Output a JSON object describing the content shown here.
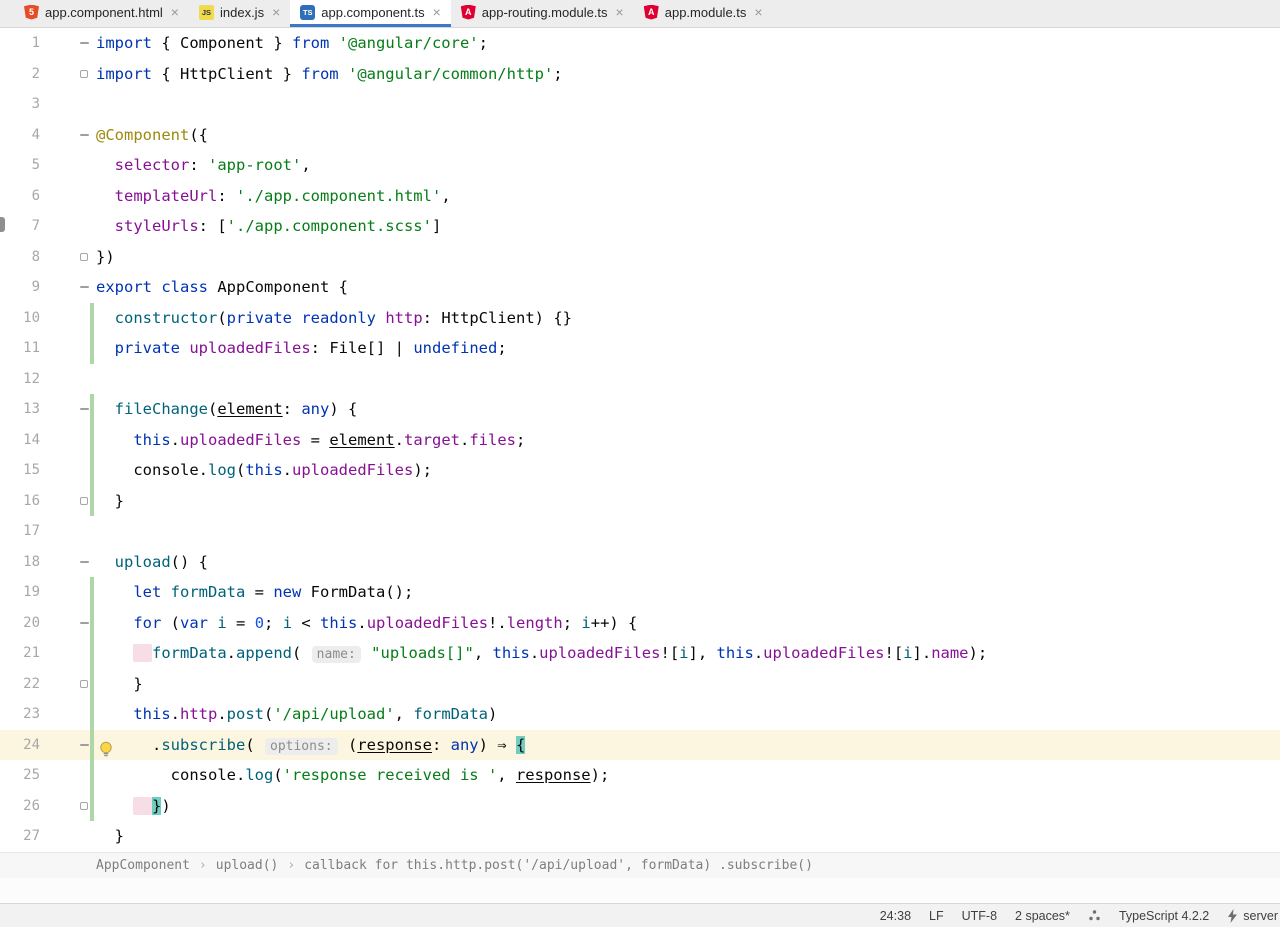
{
  "tab_bar": {
    "close_glyph": "×",
    "icon_glyphs": {
      "html": "5",
      "js": "JS",
      "ts": "TS",
      "ng": "A"
    },
    "tabs": [
      {
        "label": "app.component.html",
        "icon": "html",
        "active": false
      },
      {
        "label": "index.js",
        "icon": "js",
        "active": false
      },
      {
        "label": "app.component.ts",
        "icon": "ts",
        "active": true
      },
      {
        "label": "app-routing.module.ts",
        "icon": "ng",
        "active": false
      },
      {
        "label": "app.module.ts",
        "icon": "ng",
        "active": false
      }
    ]
  },
  "editor": {
    "lines": [
      {
        "n": 1,
        "fold": "start",
        "seg": [
          [
            "k",
            "import"
          ],
          [
            "d",
            " { Component } "
          ],
          [
            "k",
            "from"
          ],
          [
            "d",
            " "
          ],
          [
            "s",
            "'@angular/core'"
          ],
          [
            "d",
            ";"
          ]
        ]
      },
      {
        "n": 2,
        "fold": "end",
        "seg": [
          [
            "k",
            "import"
          ],
          [
            "d",
            " { HttpClient } "
          ],
          [
            "k",
            "from"
          ],
          [
            "d",
            " "
          ],
          [
            "s",
            "'@angular/common/http'"
          ],
          [
            "d",
            ";"
          ]
        ]
      },
      {
        "n": 3,
        "seg": []
      },
      {
        "n": 4,
        "fold": "start",
        "seg": [
          [
            "dec",
            "@Component"
          ],
          [
            "d",
            "({"
          ]
        ]
      },
      {
        "n": 5,
        "seg": [
          [
            "d",
            "  "
          ],
          [
            "f",
            "selector"
          ],
          [
            "d",
            ": "
          ],
          [
            "s",
            "'app-root'"
          ],
          [
            "d",
            ","
          ]
        ]
      },
      {
        "n": 6,
        "seg": [
          [
            "d",
            "  "
          ],
          [
            "f",
            "templateUrl"
          ],
          [
            "d",
            ": "
          ],
          [
            "s",
            "'./app.component.html'"
          ],
          [
            "d",
            ","
          ]
        ]
      },
      {
        "n": 7,
        "seg": [
          [
            "d",
            "  "
          ],
          [
            "f",
            "styleUrls"
          ],
          [
            "d",
            ": ["
          ],
          [
            "s",
            "'./app.component.scss'"
          ],
          [
            "d",
            "]"
          ]
        ]
      },
      {
        "n": 8,
        "fold": "end",
        "seg": [
          [
            "d",
            "})"
          ]
        ]
      },
      {
        "n": 9,
        "fold": "start",
        "seg": [
          [
            "k",
            "export"
          ],
          [
            "d",
            " "
          ],
          [
            "k",
            "class"
          ],
          [
            "d",
            " AppComponent {"
          ]
        ]
      },
      {
        "n": 10,
        "vcs": true,
        "seg": [
          [
            "d",
            "  "
          ],
          [
            "m",
            "constructor"
          ],
          [
            "d",
            "("
          ],
          [
            "k",
            "private"
          ],
          [
            "d",
            " "
          ],
          [
            "k",
            "readonly"
          ],
          [
            "d",
            " "
          ],
          [
            "f",
            "http"
          ],
          [
            "d",
            ": HttpClient) {}"
          ]
        ]
      },
      {
        "n": 11,
        "vcs": true,
        "seg": [
          [
            "d",
            "  "
          ],
          [
            "k",
            "private"
          ],
          [
            "d",
            " "
          ],
          [
            "f",
            "uploadedFiles"
          ],
          [
            "d",
            ": File[] | "
          ],
          [
            "k",
            "undefined"
          ],
          [
            "d",
            ";"
          ]
        ]
      },
      {
        "n": 12,
        "seg": []
      },
      {
        "n": 13,
        "fold": "start",
        "vcs": true,
        "seg": [
          [
            "d",
            "  "
          ],
          [
            "m",
            "fileChange"
          ],
          [
            "d",
            "("
          ],
          [
            "p",
            "element"
          ],
          [
            "d",
            ": "
          ],
          [
            "k",
            "any"
          ],
          [
            "d",
            ") {"
          ]
        ]
      },
      {
        "n": 14,
        "vcs": true,
        "seg": [
          [
            "d",
            "    "
          ],
          [
            "k",
            "this"
          ],
          [
            "d",
            "."
          ],
          [
            "f",
            "uploadedFiles"
          ],
          [
            "d",
            " = "
          ],
          [
            "p",
            "element"
          ],
          [
            "d",
            "."
          ],
          [
            "f",
            "target"
          ],
          [
            "d",
            "."
          ],
          [
            "f",
            "files"
          ],
          [
            "d",
            ";"
          ]
        ]
      },
      {
        "n": 15,
        "vcs": true,
        "seg": [
          [
            "d",
            "    console."
          ],
          [
            "m",
            "log"
          ],
          [
            "d",
            "("
          ],
          [
            "k",
            "this"
          ],
          [
            "d",
            "."
          ],
          [
            "f",
            "uploadedFiles"
          ],
          [
            "d",
            ");"
          ]
        ]
      },
      {
        "n": 16,
        "fold": "end",
        "vcs": true,
        "seg": [
          [
            "d",
            "  }"
          ]
        ]
      },
      {
        "n": 17,
        "seg": []
      },
      {
        "n": 18,
        "fold": "start",
        "seg": [
          [
            "d",
            "  "
          ],
          [
            "m",
            "upload"
          ],
          [
            "d",
            "() {"
          ]
        ]
      },
      {
        "n": 19,
        "vcs": true,
        "seg": [
          [
            "d",
            "    "
          ],
          [
            "k",
            "let"
          ],
          [
            "d",
            " "
          ],
          [
            "v",
            "formData"
          ],
          [
            "d",
            " = "
          ],
          [
            "k",
            "new"
          ],
          [
            "d",
            " FormData();"
          ]
        ]
      },
      {
        "n": 20,
        "fold": "start",
        "vcs": true,
        "seg": [
          [
            "d",
            "    "
          ],
          [
            "k",
            "for"
          ],
          [
            "d",
            " ("
          ],
          [
            "k",
            "var"
          ],
          [
            "d",
            " "
          ],
          [
            "v",
            "i"
          ],
          [
            "d",
            " = "
          ],
          [
            "n",
            "0"
          ],
          [
            "d",
            "; "
          ],
          [
            "v",
            "i"
          ],
          [
            "d",
            " < "
          ],
          [
            "k",
            "this"
          ],
          [
            "d",
            "."
          ],
          [
            "f",
            "uploadedFiles"
          ],
          [
            "d",
            "!."
          ],
          [
            "f",
            "length"
          ],
          [
            "d",
            "; "
          ],
          [
            "v",
            "i"
          ],
          [
            "d",
            "++) {"
          ]
        ]
      },
      {
        "n": 21,
        "vcs": true,
        "seg": [
          [
            "d",
            "    "
          ],
          [
            "chip",
            "  "
          ],
          [
            "v",
            "formData"
          ],
          [
            "d",
            "."
          ],
          [
            "m",
            "append"
          ],
          [
            "d",
            "( "
          ],
          [
            "hint",
            "name:"
          ],
          [
            "d",
            " "
          ],
          [
            "s",
            "\"uploads[]\""
          ],
          [
            "d",
            ", "
          ],
          [
            "k",
            "this"
          ],
          [
            "d",
            "."
          ],
          [
            "f",
            "uploadedFiles"
          ],
          [
            "d",
            "!["
          ],
          [
            "v",
            "i"
          ],
          [
            "d",
            "], "
          ],
          [
            "k",
            "this"
          ],
          [
            "d",
            "."
          ],
          [
            "f",
            "uploadedFiles"
          ],
          [
            "d",
            "!["
          ],
          [
            "v",
            "i"
          ],
          [
            "d",
            "]."
          ],
          [
            "f",
            "name"
          ],
          [
            "d",
            ");"
          ]
        ]
      },
      {
        "n": 22,
        "fold": "end",
        "vcs": true,
        "seg": [
          [
            "d",
            "    }"
          ]
        ]
      },
      {
        "n": 23,
        "vcs": true,
        "seg": [
          [
            "d",
            "    "
          ],
          [
            "k",
            "this"
          ],
          [
            "d",
            "."
          ],
          [
            "f",
            "http"
          ],
          [
            "d",
            "."
          ],
          [
            "m",
            "post"
          ],
          [
            "d",
            "("
          ],
          [
            "s",
            "'/api/upload'"
          ],
          [
            "d",
            ", "
          ],
          [
            "v",
            "formData"
          ],
          [
            "d",
            ")"
          ]
        ]
      },
      {
        "n": 24,
        "fold": "start",
        "vcs": true,
        "hl": true,
        "bulb": true,
        "seg": [
          [
            "d",
            "      ."
          ],
          [
            "m",
            "subscribe"
          ],
          [
            "d",
            "( "
          ],
          [
            "hint",
            "options:"
          ],
          [
            "d",
            " ("
          ],
          [
            "p",
            "response"
          ],
          [
            "d",
            ": "
          ],
          [
            "k",
            "any"
          ],
          [
            "d",
            ") ⇒ "
          ],
          [
            "brace",
            "{"
          ]
        ]
      },
      {
        "n": 25,
        "vcs": true,
        "seg": [
          [
            "d",
            "        console."
          ],
          [
            "m",
            "log"
          ],
          [
            "d",
            "("
          ],
          [
            "s",
            "'response received is '"
          ],
          [
            "d",
            ", "
          ],
          [
            "p",
            "response"
          ],
          [
            "d",
            ");"
          ]
        ]
      },
      {
        "n": 26,
        "fold": "end",
        "vcs": true,
        "seg": [
          [
            "d",
            "    "
          ],
          [
            "chip",
            "  "
          ],
          [
            "brace",
            "}"
          ],
          [
            "d",
            ")"
          ]
        ]
      },
      {
        "n": 27,
        "seg": [
          [
            "d",
            "  }"
          ]
        ]
      }
    ]
  },
  "breadcrumbs": {
    "separator": "›",
    "items": [
      "AppComponent",
      "upload()",
      "callback for this.http.post('/api/upload', formData) .subscribe()"
    ]
  },
  "status_bar": {
    "items": [
      {
        "name": "caret-position",
        "label": "24:38"
      },
      {
        "name": "line-separator",
        "label": "LF"
      },
      {
        "name": "encoding",
        "label": "UTF-8"
      },
      {
        "name": "indent",
        "label": "2 spaces*"
      },
      {
        "name": "inspections-widget",
        "icon": "inspections"
      },
      {
        "name": "typescript-version",
        "label": "TypeScript 4.2.2"
      },
      {
        "name": "ts-server",
        "icon": "bolt",
        "label": "server"
      }
    ]
  },
  "colors": {
    "accent_underline": "#3979C8",
    "tab_bar_bg": "#EDEDED",
    "editor_bg": "#FFFFFF",
    "current_line_bg": "#FCF5DF",
    "brace_match_bg": "#6FCDC2",
    "vcs_added_bar": "#AED7A8",
    "fold_chip_bg": "#F6DDE6",
    "hint_chip_bg": "#EDEDED",
    "status_bar_bg": "#F2F2F2",
    "icon_html": "#E44D26",
    "icon_js": "#F0DB4F",
    "icon_ts": "#2F6FB7",
    "icon_ng": "#DD0031",
    "tokens": {
      "k": "#0033B3",
      "s": "#067D17",
      "n": "#1750EB",
      "f": "#871094",
      "m": "#00627A",
      "v": "#00627A",
      "d": "#080808",
      "dec": "#9E880D",
      "hint": "#8C8C8C"
    }
  }
}
